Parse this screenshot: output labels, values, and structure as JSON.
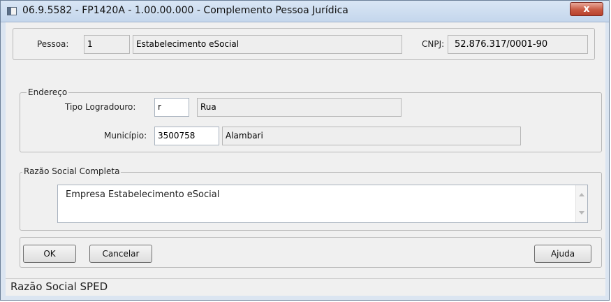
{
  "window": {
    "title": "06.9.5582 - FP1420A - 1.00.00.000 - Complemento Pessoa Jurídica",
    "close_label": "x"
  },
  "pessoa": {
    "label": "Pessoa:",
    "value": "1",
    "name": "Estabelecimento eSocial",
    "cnpj_label": "CNPJ:",
    "cnpj_value": "52.876.317/0001-90"
  },
  "endereco": {
    "legend": "Endereço",
    "tipo_label": "Tipo Logradouro:",
    "tipo_value": "r",
    "tipo_desc": "Rua",
    "municipio_label": "Município:",
    "municipio_value": "3500758",
    "municipio_desc": "Alambari"
  },
  "razao": {
    "legend": "Razão Social Completa",
    "value": "Empresa Estabelecimento eSocial"
  },
  "buttons": {
    "ok": "OK",
    "cancel": "Cancelar",
    "help": "Ajuda"
  },
  "status": {
    "text": "Razão Social SPED"
  }
}
